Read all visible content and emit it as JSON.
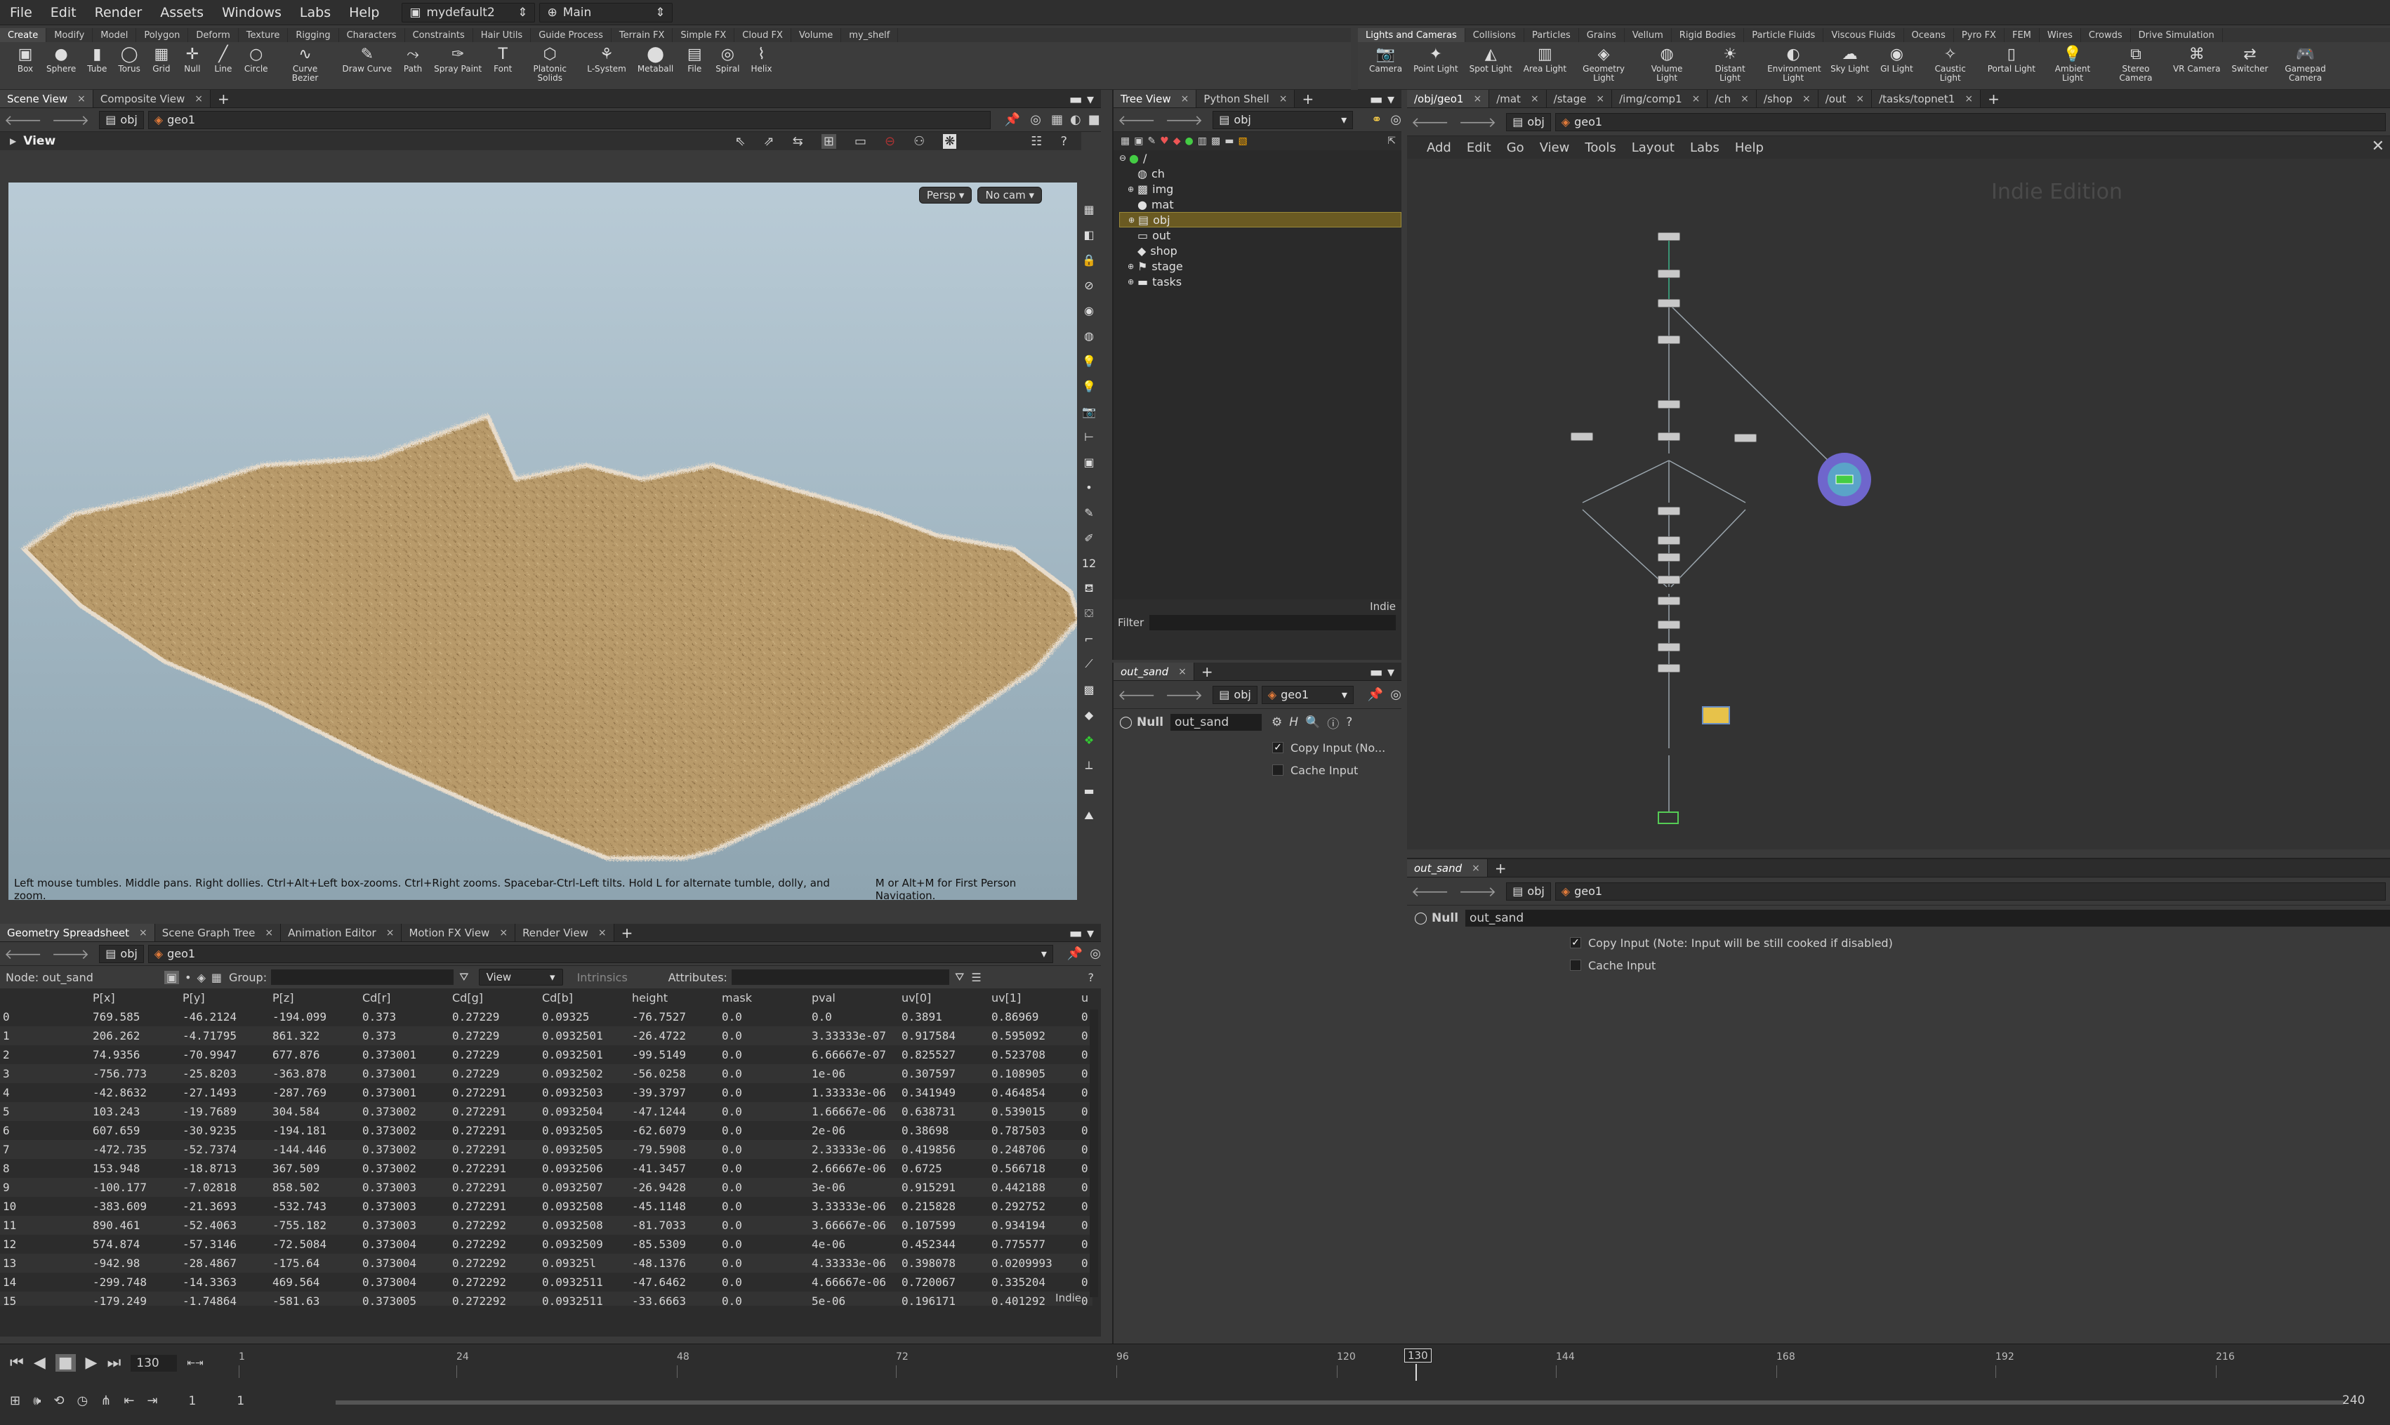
{
  "menubar": {
    "items": [
      "File",
      "Edit",
      "Render",
      "Assets",
      "Windows",
      "Labs",
      "Help"
    ],
    "desktop": "mydefault2",
    "context": "Main"
  },
  "shelf_left": {
    "tabs": [
      "Create",
      "Modify",
      "Model",
      "Polygon",
      "Deform",
      "Texture",
      "Rigging",
      "Characters",
      "Constraints",
      "Hair Utils",
      "Guide Process",
      "Terrain FX",
      "Simple FX",
      "Cloud FX",
      "Volume",
      "my_shelf"
    ],
    "tools": [
      "Box",
      "Sphere",
      "Tube",
      "Torus",
      "Grid",
      "Null",
      "Line",
      "Circle",
      "Curve Bezier",
      "Draw Curve",
      "Path",
      "Spray Paint",
      "Font",
      "Platonic Solids",
      "L-System",
      "Metaball",
      "File",
      "Spiral",
      "Helix"
    ]
  },
  "shelf_right": {
    "tabs": [
      "Lights and Cameras",
      "Collisions",
      "Particles",
      "Grains",
      "Vellum",
      "Rigid Bodies",
      "Particle Fluids",
      "Viscous Fluids",
      "Oceans",
      "Pyro FX",
      "FEM",
      "Wires",
      "Crowds",
      "Drive Simulation"
    ],
    "tools": [
      "Camera",
      "Point Light",
      "Spot Light",
      "Area Light",
      "Geometry Light",
      "Volume Light",
      "Distant Light",
      "Environment Light",
      "Sky Light",
      "GI Light",
      "Caustic Light",
      "Portal Light",
      "Ambient Light",
      "Stereo Camera",
      "VR Camera",
      "Switcher",
      "Gamepad Camera"
    ]
  },
  "viewport": {
    "tabs": [
      "Scene View",
      "Composite View"
    ],
    "path": [
      "obj",
      "geo1"
    ],
    "title": "View",
    "persp": "Persp",
    "cam": "No cam",
    "hint": "Left mouse tumbles. Middle pans. Right dollies. Ctrl+Alt+Left box-zooms. Ctrl+Right zooms. Spacebar-Ctrl-Left tilts. Hold L for alternate tumble, dolly, and zoom.",
    "hint2": "M or Alt+M for First Person Navigation."
  },
  "tree": {
    "tabs": [
      "Tree View",
      "Python Shell"
    ],
    "path": "obj",
    "root": "/",
    "items": [
      "ch",
      "img",
      "mat",
      "obj",
      "out",
      "shop",
      "stage",
      "tasks"
    ],
    "selected": "obj",
    "badge": "Indie",
    "filter_label": "Filter"
  },
  "params_small": {
    "tab": "out_sand",
    "path": [
      "obj",
      "geo1"
    ],
    "node_type": "Null",
    "node_name": "out_sand",
    "copy_input": "Copy Input (No...",
    "cache_input": "Cache Input"
  },
  "network": {
    "tabs": [
      "/obj/geo1",
      "/mat",
      "/stage",
      "/img/comp1",
      "/ch",
      "/shop",
      "/out",
      "/tasks/topnet1"
    ],
    "path": [
      "obj",
      "geo1"
    ],
    "menu": [
      "Add",
      "Edit",
      "Go",
      "View",
      "Tools",
      "Layout",
      "Labs",
      "Help"
    ],
    "watermark": "Indie Edition"
  },
  "params_big": {
    "tab": "out_sand",
    "path": [
      "obj",
      "geo1"
    ],
    "node_type": "Null",
    "node_name": "out_sand",
    "copy_input": "Copy Input (Note: Input will be still cooked if disabled)",
    "cache_input": "Cache Input"
  },
  "spreadsheet": {
    "tabs": [
      "Geometry Spreadsheet",
      "Scene Graph Tree",
      "Animation Editor",
      "Motion FX View",
      "Render View"
    ],
    "path": [
      "obj",
      "geo1"
    ],
    "node_label": "Node: out_sand",
    "group_label": "Group:",
    "view_label": "View",
    "intrinsics_label": "Intrinsics",
    "attributes_label": "Attributes:",
    "columns": [
      "",
      "P[x]",
      "P[y]",
      "P[z]",
      "Cd[r]",
      "Cd[g]",
      "Cd[b]",
      "height",
      "mask",
      "pval",
      "uv[0]",
      "uv[1]",
      "u"
    ],
    "rows": [
      [
        "0",
        "769.585",
        "-46.2124",
        "-194.099",
        "0.373",
        "0.27229",
        "0.09325",
        "-76.7527",
        "0.0",
        "0.0",
        "0.3891",
        "0.86969",
        "0"
      ],
      [
        "1",
        "206.262",
        "-4.71795",
        "861.322",
        "0.373",
        "0.27229",
        "0.0932501",
        "-26.4722",
        "0.0",
        "3.33333e-07",
        "0.917584",
        "0.595092",
        "0"
      ],
      [
        "2",
        "74.9356",
        "-70.9947",
        "677.876",
        "0.373001",
        "0.27229",
        "0.0932501",
        "-99.5149",
        "0.0",
        "6.66667e-07",
        "0.825527",
        "0.523708",
        "0"
      ],
      [
        "3",
        "-756.773",
        "-25.8203",
        "-363.878",
        "0.373001",
        "0.27229",
        "0.0932502",
        "-56.0258",
        "0.0",
        "1e-06",
        "0.307597",
        "0.108905",
        "0"
      ],
      [
        "4",
        "-42.8632",
        "-27.1493",
        "-287.769",
        "0.373001",
        "0.272291",
        "0.0932503",
        "-39.3797",
        "0.0",
        "1.33333e-06",
        "0.341949",
        "0.464854",
        "0"
      ],
      [
        "5",
        "103.243",
        "-19.7689",
        "304.584",
        "0.373002",
        "0.272291",
        "0.0932504",
        "-47.1244",
        "0.0",
        "1.66667e-06",
        "0.638731",
        "0.539015",
        "0"
      ],
      [
        "6",
        "607.659",
        "-30.9235",
        "-194.181",
        "0.373002",
        "0.272291",
        "0.0932505",
        "-62.6079",
        "0.0",
        "2e-06",
        "0.38698",
        "0.787503",
        "0"
      ],
      [
        "7",
        "-472.735",
        "-52.7374",
        "-144.446",
        "0.373002",
        "0.272291",
        "0.0932505",
        "-79.5908",
        "0.0",
        "2.33333e-06",
        "0.419856",
        "0.248706",
        "0"
      ],
      [
        "8",
        "153.948",
        "-18.8713",
        "367.509",
        "0.373002",
        "0.272291",
        "0.0932506",
        "-41.3457",
        "0.0",
        "2.66667e-06",
        "0.6725",
        "0.566718",
        "0"
      ],
      [
        "9",
        "-100.177",
        "-7.02818",
        "858.502",
        "0.373003",
        "0.272291",
        "0.0932507",
        "-26.9428",
        "0.0",
        "3e-06",
        "0.915291",
        "0.442188",
        "0"
      ],
      [
        "10",
        "-383.609",
        "-21.3693",
        "-532.743",
        "0.373003",
        "0.272291",
        "0.0932508",
        "-45.1148",
        "0.0",
        "3.33333e-06",
        "0.215828",
        "0.292752",
        "0"
      ],
      [
        "11",
        "890.461",
        "-52.4063",
        "-755.182",
        "0.373003",
        "0.272292",
        "0.0932508",
        "-81.7033",
        "0.0",
        "3.66667e-06",
        "0.107599",
        "0.934194",
        "0"
      ],
      [
        "12",
        "574.874",
        "-57.3146",
        "-72.5084",
        "0.373004",
        "0.272292",
        "0.0932509",
        "-85.5309",
        "0.0",
        "4e-06",
        "0.452344",
        "0.775577",
        "0"
      ],
      [
        "13",
        "-942.98",
        "-28.4867",
        "-175.64",
        "0.373004",
        "0.272292",
        "0.09325l",
        "-48.1376",
        "0.0",
        "4.33333e-06",
        "0.398078",
        "0.0209993",
        "0"
      ],
      [
        "14",
        "-299.748",
        "-14.3363",
        "469.564",
        "0.373004",
        "0.272292",
        "0.0932511",
        "-47.6462",
        "0.0",
        "4.66667e-06",
        "0.720067",
        "0.335204",
        "0"
      ],
      [
        "15",
        "-179.249",
        "-1.74864",
        "-581.63",
        "0.373005",
        "0.272292",
        "0.0932511",
        "-33.6663",
        "0.0",
        "5e-06",
        "0.196171",
        "0.401292",
        "0"
      ]
    ],
    "indie": "Indie"
  },
  "timeline": {
    "frame": "130",
    "ticks": [
      "1",
      "24",
      "48",
      "72",
      "96",
      "120",
      "144",
      "168",
      "192",
      "216"
    ],
    "current_marker": "130",
    "start": "1",
    "range_start": "1",
    "end": "240"
  },
  "colors": {
    "accent_selected": "#6a5a22",
    "sky_top": "#b9cbd6",
    "sky_bottom": "#94a9b5",
    "sand": "#b89a6a",
    "node_purple": "#7b6fd6"
  }
}
